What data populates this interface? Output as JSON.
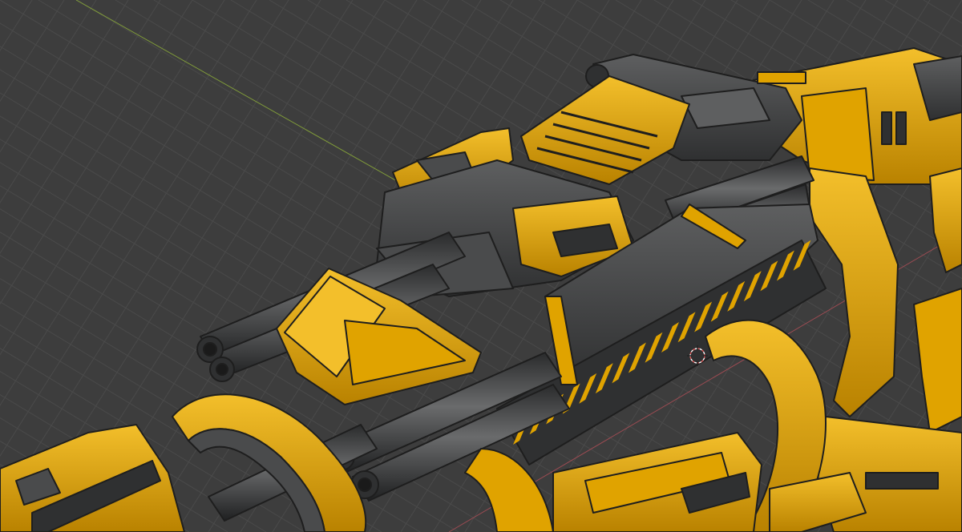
{
  "viewport": {
    "background": "#3d3d3d",
    "grid_color": "#4a4a4a",
    "grid_subdivision_color": "#454545",
    "x_axis_color": "#9a4b52",
    "y_axis_color": "#7f9a3a",
    "cursor_color": "#e05a5a"
  },
  "model": {
    "primary_color": "#e0a300",
    "primary_shade": "#b98200",
    "primary_highlight": "#f3bf2b",
    "secondary_color": "#4a4b4c",
    "secondary_shade": "#2f3031",
    "secondary_highlight": "#5e5f60",
    "edge_color": "#1e1e1e"
  },
  "icons": {
    "cursor": "3d-cursor-icon"
  }
}
